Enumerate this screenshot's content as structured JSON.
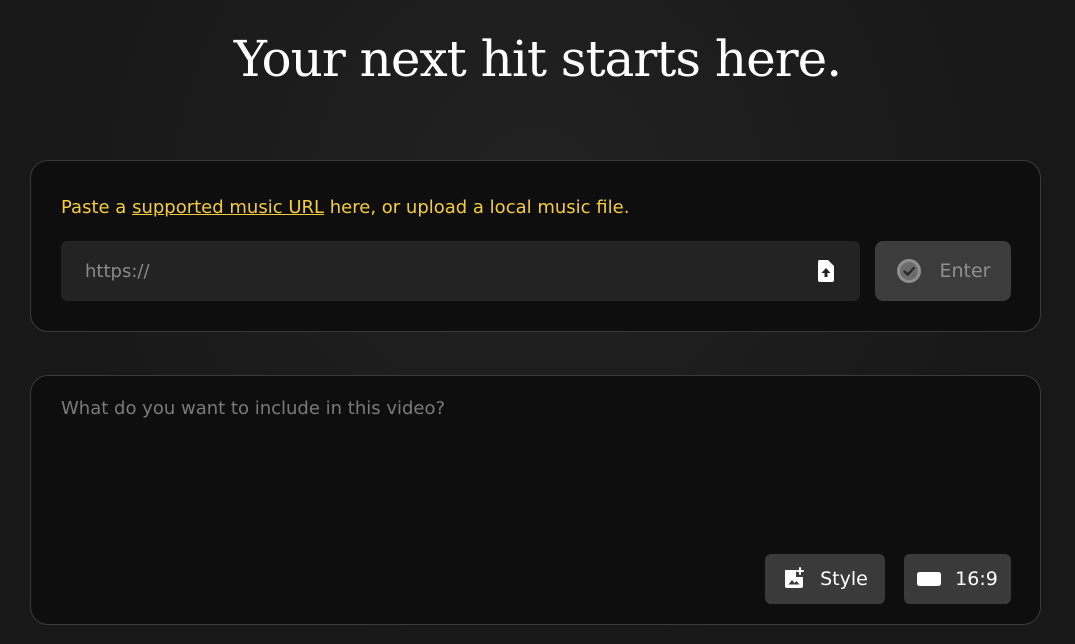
{
  "headline": "Your next hit starts here.",
  "url_card": {
    "hint_prefix": "Paste a ",
    "hint_link": "supported music URL",
    "hint_suffix": " here, or upload a local music file.",
    "url_input": {
      "value": "",
      "placeholder": "https://"
    },
    "upload_icon": "file-upload-icon",
    "enter_button": {
      "label": "Enter",
      "icon": "check-circle-icon"
    }
  },
  "prompt_card": {
    "prompt_input": {
      "value": "",
      "placeholder": "What do you want to include in this video?"
    },
    "style_button": {
      "label": "Style",
      "icon": "image-add-icon"
    },
    "aspect_button": {
      "label": "16:9",
      "icon": "aspect-ratio-icon"
    }
  },
  "colors": {
    "background": "#1b1b1b",
    "card": "#0e0e0e",
    "accent_yellow": "#f5cd3c",
    "button": "#3a3a3a"
  }
}
